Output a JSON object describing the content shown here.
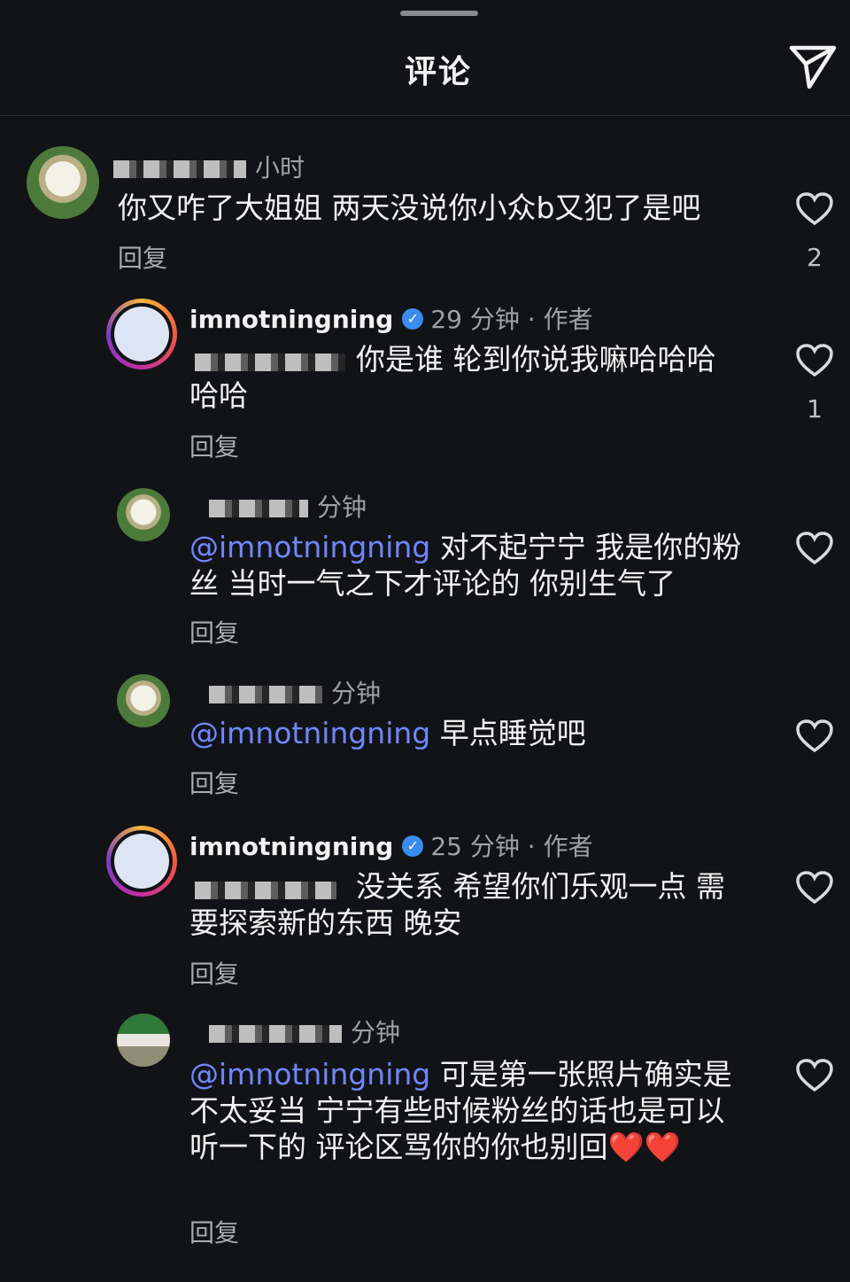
{
  "header": {
    "title": "评论",
    "share_icon": "send-icon"
  },
  "comments": [
    {
      "author_hidden": true,
      "time": "小时",
      "text": "你又咋了大姐姐 两天没说你小众b又犯了是吧",
      "reply_label": "回复",
      "likes": "2"
    },
    {
      "author": "imnotningning",
      "time": "29 分钟",
      "author_tag": "· 作者",
      "text": "你是谁 轮到你说我嘛哈哈哈哈哈",
      "reply_label": "回复",
      "likes": "1"
    },
    {
      "time": "分钟",
      "mention": "@imnotningning",
      "text": "对不起宁宁 我是你的粉丝 当时一气之下才评论的 你别生气了",
      "reply_label": "回复"
    },
    {
      "time": "分钟",
      "mention": "@imnotningning",
      "text": "早点睡觉吧",
      "reply_label": "回复"
    },
    {
      "author": "imnotningning",
      "time": "25 分钟",
      "author_tag": "· 作者",
      "text": "没关系 希望你们乐观一点 需要探索新的东西 晚安",
      "reply_label": "回复"
    },
    {
      "time": "分钟",
      "mention": "@imnotningning",
      "text": "可是第一张照片确实是不太妥当 宁宁有些时候粉丝的话也是可以听一下的 评论区骂你的你也别回❤️❤️",
      "reply_label": "回复"
    }
  ]
}
